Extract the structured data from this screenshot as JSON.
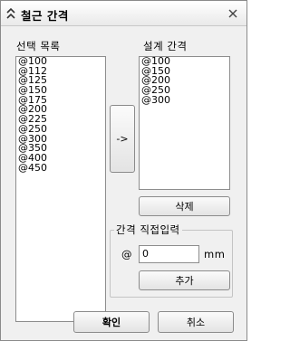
{
  "window": {
    "title": "철근 간격",
    "title_icon": "chevrons-icon",
    "close_icon": "close-icon"
  },
  "select_list": {
    "label": "선택 목록",
    "items": [
      "@100",
      "@112",
      "@125",
      "@150",
      "@175",
      "@200",
      "@225",
      "@250",
      "@300",
      "@350",
      "@400",
      "@450"
    ]
  },
  "design_list": {
    "label": "설계 간격",
    "items": [
      "@100",
      "@150",
      "@200",
      "@250",
      "@300"
    ]
  },
  "buttons": {
    "move": "->",
    "delete": "삭제",
    "add": "추가",
    "ok": "확인",
    "cancel": "취소"
  },
  "direct_input": {
    "group_label": "간격 직접입력",
    "prefix": "@",
    "value": "0",
    "unit": "mm"
  }
}
